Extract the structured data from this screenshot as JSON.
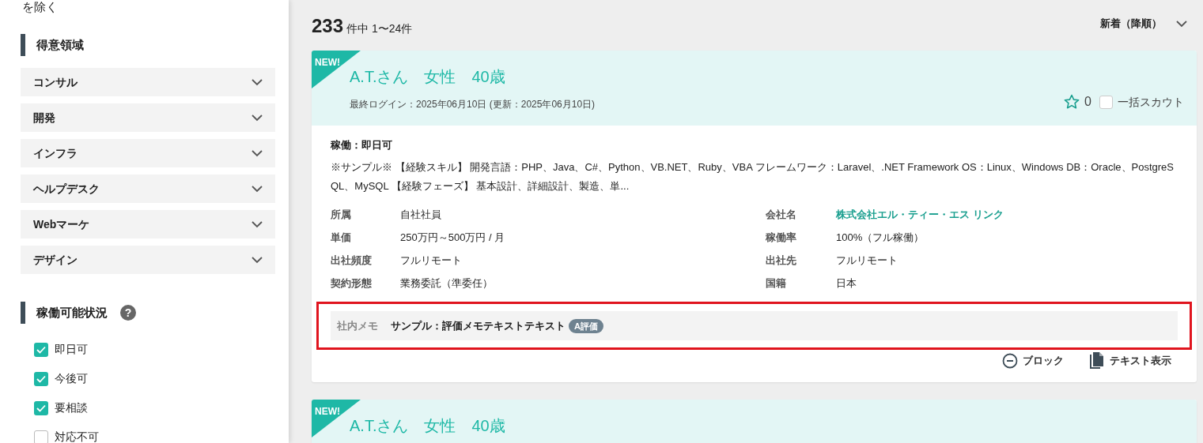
{
  "sidebar": {
    "excluded_text": "を除く",
    "sections": [
      {
        "kind": "accordion",
        "title": "得意領域",
        "items": [
          {
            "label": "コンサル",
            "expanded": false
          },
          {
            "label": "開発",
            "expanded": false
          },
          {
            "label": "インフラ",
            "expanded": false
          },
          {
            "label": "ヘルプデスク",
            "expanded": false
          },
          {
            "label": "Webマーケ",
            "expanded": false
          },
          {
            "label": "デザイン",
            "expanded": false
          }
        ]
      },
      {
        "kind": "checkboxes",
        "title": "稼働可能状況",
        "help": "?",
        "items": [
          {
            "label": "即日可",
            "checked": true
          },
          {
            "label": "今後可",
            "checked": true
          },
          {
            "label": "要相談",
            "checked": true
          },
          {
            "label": "対応不可",
            "checked": false
          }
        ]
      }
    ]
  },
  "results": {
    "total": "233",
    "range_text": "件中 1〜24件",
    "sort": "新着（降順）"
  },
  "cards": [
    {
      "badge": "NEW!",
      "name": "A.T.さん　女性　40歳",
      "last_login": "最終ログイン：2025年06月10日 (更新：2025年06月10日)",
      "favorites": "0",
      "favorited": false,
      "scout_label": "一括スカウト",
      "scout_checked": false,
      "availability": "稼働：即日可",
      "summary": "※サンプル※ 【経験スキル】 開発言語：PHP、Java、C#、Python、VB.NET、Ruby、VBA フレームワーク：Laravel、.NET Framework OS：Linux、Windows DB：Oracle、PostgreSQL、MySQL 【経験フェーズ】 基本設計、詳細設計、製造、単...",
      "fields": [
        {
          "label": "所属",
          "value": "自社社員",
          "kind": "text"
        },
        {
          "label": "会社名",
          "value": "株式会社エル・ティー・エス リンク",
          "kind": "link"
        },
        {
          "label": "単価",
          "value": "250万円～500万円 / 月",
          "kind": "text"
        },
        {
          "label": "稼働率",
          "value": "100%（フル稼働）",
          "kind": "text"
        },
        {
          "label": "出社頻度",
          "value": "フルリモート",
          "kind": "text"
        },
        {
          "label": "出社先",
          "value": "フルリモート",
          "kind": "text"
        },
        {
          "label": "契約形態",
          "value": "業務委託（準委任）",
          "kind": "text"
        },
        {
          "label": "国籍",
          "value": "日本",
          "kind": "text"
        }
      ],
      "memo": {
        "label": "社内メモ",
        "text": "サンプル：評価メモテキストテキスト",
        "tag": "A評価",
        "highlighted": true
      },
      "actions": [
        {
          "kind": "block",
          "label": "ブロック"
        },
        {
          "kind": "text",
          "label": "テキスト表示"
        }
      ]
    },
    {
      "badge": "NEW!",
      "name": "A.T.さん　女性　40歳"
    }
  ]
}
